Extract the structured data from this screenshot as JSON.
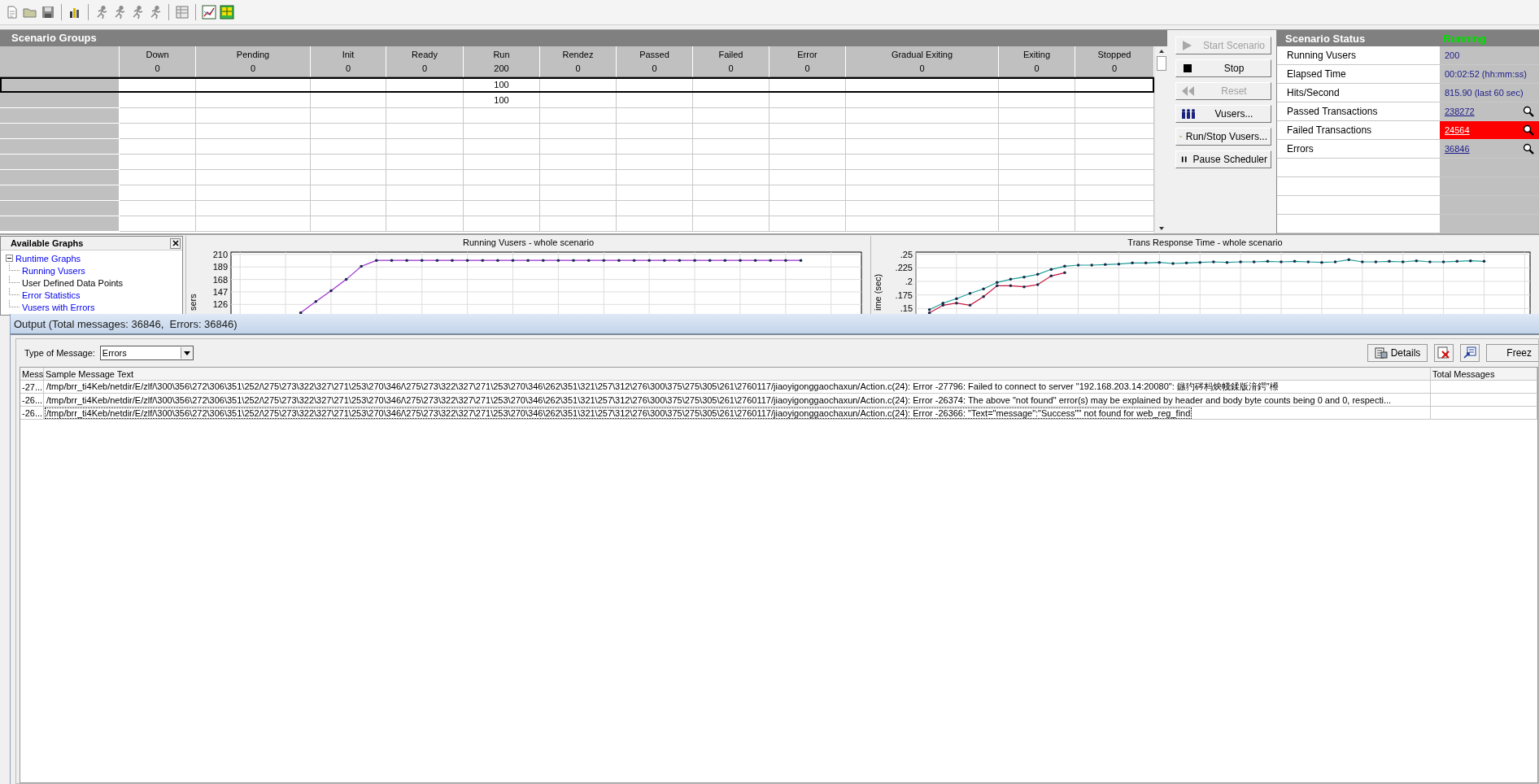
{
  "scenario_groups": {
    "title": "Scenario Groups",
    "columns": [
      {
        "label": "Down",
        "count": "0"
      },
      {
        "label": "Pending",
        "count": "0"
      },
      {
        "label": "Init",
        "count": "0"
      },
      {
        "label": "Ready",
        "count": "0"
      },
      {
        "label": "Run",
        "count": "200"
      },
      {
        "label": "Rendez",
        "count": "0"
      },
      {
        "label": "Passed",
        "count": "0"
      },
      {
        "label": "Failed",
        "count": "0"
      },
      {
        "label": "Error",
        "count": "0"
      },
      {
        "label": "Gradual Exiting",
        "count": "0"
      },
      {
        "label": "Exiting",
        "count": "0"
      },
      {
        "label": "Stopped",
        "count": "0"
      }
    ],
    "rows": [
      {
        "selected": true,
        "run": "100"
      },
      {
        "selected": false,
        "run": "100"
      }
    ]
  },
  "controls": [
    {
      "label": "Start Scenario",
      "kind": "play",
      "disabled": true
    },
    {
      "label": "Stop",
      "kind": "stop",
      "disabled": false
    },
    {
      "label": "Reset",
      "kind": "rewind",
      "disabled": true
    },
    {
      "label": "Vusers...",
      "kind": "people",
      "disabled": false
    },
    {
      "label": "Run/Stop Vusers...",
      "kind": "runstop",
      "disabled": false
    },
    {
      "label": "Pause Scheduler",
      "kind": "pause",
      "disabled": false
    }
  ],
  "scenario_status": {
    "title": "Scenario Status",
    "state": "Running",
    "rows": [
      {
        "label": "Running Vusers",
        "value": "200",
        "link": false,
        "alert": false
      },
      {
        "label": "Elapsed Time",
        "value": "00:02:52 (hh:mm:ss)",
        "link": false,
        "alert": false
      },
      {
        "label": "Hits/Second",
        "value": "815.90 (last 60 sec)",
        "link": false,
        "alert": false
      },
      {
        "label": "Passed Transactions",
        "value": "238272",
        "link": true,
        "alert": false
      },
      {
        "label": "Failed Transactions",
        "value": "24564",
        "link": true,
        "alert": true
      },
      {
        "label": "Errors",
        "value": "36846",
        "link": true,
        "alert": false
      }
    ]
  },
  "available_graphs": {
    "title": "Available Graphs",
    "tree": [
      {
        "label": "Runtime Graphs",
        "expanded": true,
        "children": [
          {
            "label": "Running Vusers",
            "has_data": true
          },
          {
            "label": "User Defined Data Points",
            "has_data": false
          },
          {
            "label": "Error Statistics",
            "has_data": true
          },
          {
            "label": "Vusers with Errors",
            "has_data": true
          }
        ]
      }
    ]
  },
  "graphs": [
    {
      "title": "Running Vusers - whole scenario",
      "chart_data": {
        "type": "line",
        "ylabel": "sers",
        "grid": true,
        "ylim": [
          110,
          214
        ],
        "yticks": [
          126,
          147,
          168,
          189,
          210
        ],
        "series": [
          {
            "color": "#9b30d0",
            "values": [
              null,
              null,
              null,
              null,
              112,
              131,
              149,
              168,
              190,
              200,
              200,
              200,
              200,
              200,
              200,
              200,
              200,
              200,
              200,
              200,
              200,
              200,
              200,
              200,
              200,
              200,
              200,
              200,
              200,
              200,
              200,
              200,
              200,
              200,
              200,
              200,
              200,
              200
            ]
          }
        ]
      }
    },
    {
      "title": "Trans Response Time - whole scenario",
      "chart_data": {
        "type": "line",
        "ylabel": "ime (sec)",
        "grid": true,
        "ylim": [
          0.14,
          0.254
        ],
        "yticks": [
          {
            "value": 0.15,
            "label": ".15"
          },
          {
            "value": 0.175,
            "label": ".175"
          },
          {
            "value": 0.2,
            "label": ".2"
          },
          {
            "value": 0.225,
            "label": ".225"
          },
          {
            "value": 0.25,
            "label": ".25"
          }
        ],
        "series": [
          {
            "color": "#1a9e96",
            "values": [
              0.148,
              0.16,
              0.168,
              0.178,
              0.186,
              0.198,
              0.204,
              0.208,
              0.213,
              0.222,
              0.228,
              0.23,
              0.23,
              0.231,
              0.232,
              0.234,
              0.234,
              0.235,
              0.233,
              0.234,
              0.235,
              0.236,
              0.235,
              0.236,
              0.236,
              0.237,
              0.236,
              0.237,
              0.236,
              0.235,
              0.236,
              0.24,
              0.236,
              0.236,
              0.237,
              0.236,
              0.238,
              0.236,
              0.236,
              0.237,
              0.238,
              0.237
            ]
          },
          {
            "color": "#c8143c",
            "values": [
              0.142,
              0.156,
              0.16,
              0.156,
              0.172,
              0.192,
              0.192,
              0.19,
              0.194,
              0.21,
              0.216,
              null,
              null,
              null,
              null,
              null,
              null,
              null,
              null,
              null,
              null,
              null,
              null,
              null,
              null,
              null,
              null,
              null,
              null,
              null,
              null,
              null,
              null,
              null,
              null,
              null,
              null,
              null,
              null,
              null,
              null,
              null
            ]
          }
        ]
      }
    }
  ],
  "output": {
    "title": "Output (Total messages: 36846,  Errors: 36846)",
    "type_label": "Type of Message:",
    "type_value": "Errors",
    "buttons": [
      {
        "label": "Details",
        "kind": "details"
      },
      {
        "kind": "delete"
      },
      {
        "kind": "export"
      },
      {
        "label": "Freez",
        "kind": "text"
      }
    ],
    "columns": [
      "Mess",
      "Sample Message Text",
      "Total Messages"
    ],
    "rows": [
      {
        "code": "-27...",
        "selected": false,
        "text": "/tmp/brr_ti4Keb/netdir/E/zlf/\\300\\356\\272\\306\\351\\252/\\275\\273\\322\\327\\271\\253\\270\\346/\\275\\273\\322\\327\\271\\253\\270\\346\\262\\351\\321\\257\\312\\276\\300\\375\\275\\305\\261\\2760117/jiaoyigonggaochaxun/Action.c(24): Error -27796: Failed to connect to server \"192.168.203.14:20080\": 鏃犳硶杩炴帴鍒版湇鍔″櫒"
      },
      {
        "code": "-26...",
        "selected": false,
        "text": "/tmp/brr_ti4Keb/netdir/E/zlf/\\300\\356\\272\\306\\351\\252/\\275\\273\\322\\327\\271\\253\\270\\346/\\275\\273\\322\\327\\271\\253\\270\\346\\262\\351\\321\\257\\312\\276\\300\\375\\275\\305\\261\\2760117/jiaoyigonggaochaxun/Action.c(24): Error -26374: The above \"not found\" error(s) may be explained by header and body byte counts being 0 and 0, respecti..."
      },
      {
        "code": "-26...",
        "selected": true,
        "text": "/tmp/brr_ti4Keb/netdir/E/zlf/\\300\\356\\272\\306\\351\\252/\\275\\273\\322\\327\\271\\253\\270\\346/\\275\\273\\322\\327\\271\\253\\270\\346\\262\\351\\321\\257\\312\\276\\300\\375\\275\\305\\261\\2760117/jiaoyigonggaochaxun/Action.c(24): Error -26366: \"Text=\"message\":\"Success\"\" not found for web_reg_find"
      }
    ]
  }
}
